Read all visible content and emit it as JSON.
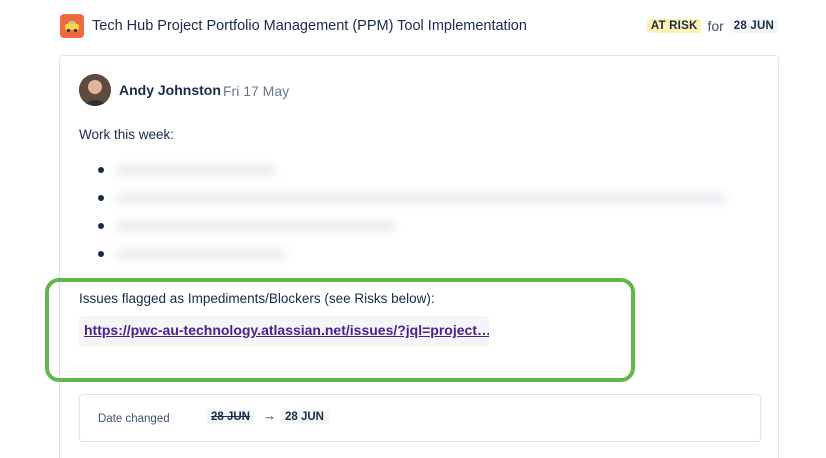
{
  "project": {
    "icon": "taxi-icon",
    "title": "Tech Hub Project Portfolio Management (PPM) Tool Implementation",
    "status": "AT RISK",
    "status_color": "#fff0b3",
    "for_text": "for",
    "target_date": "28 JUN"
  },
  "update": {
    "author": "Andy Johnston",
    "date": "Fri 17 May",
    "work_title": "Work this week:",
    "bullet_count_visible": 4,
    "issues_label": "Issues flagged as Impediments/Blockers (see Risks below):",
    "issues_link": "https://pwc-au-technology.atlassian.net/issues/?jql=project…"
  },
  "change": {
    "label": "Date changed",
    "old_date": "28 JUN",
    "arrow": "→",
    "new_date": "28 JUN"
  },
  "colors": {
    "highlight_border": "#62b64b",
    "link": "#4a1f8f",
    "icon_bg": "#f06a40"
  }
}
